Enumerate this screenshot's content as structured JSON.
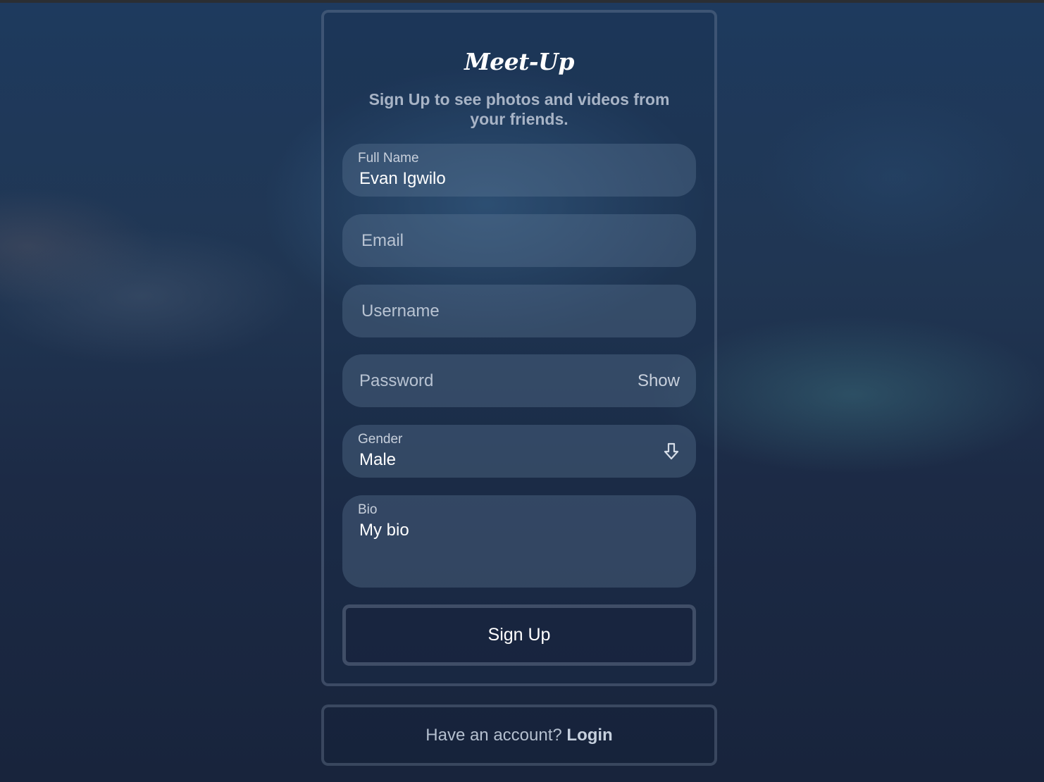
{
  "brand": {
    "name": "Meet-Up",
    "tagline": "Sign Up to see photos and videos from your friends."
  },
  "form": {
    "full_name": {
      "label": "Full Name",
      "value": "Evan Igwilo"
    },
    "email": {
      "placeholder": "Email"
    },
    "username": {
      "placeholder": "Username"
    },
    "password": {
      "placeholder": "Password",
      "toggle_label": "Show"
    },
    "gender": {
      "label": "Gender",
      "selected": "Male",
      "icon": "arrow-down-icon"
    },
    "bio": {
      "label": "Bio",
      "value": "My bio"
    },
    "submit_label": "Sign Up"
  },
  "login_prompt": {
    "text": "Have an account?",
    "link_label": "Login"
  }
}
